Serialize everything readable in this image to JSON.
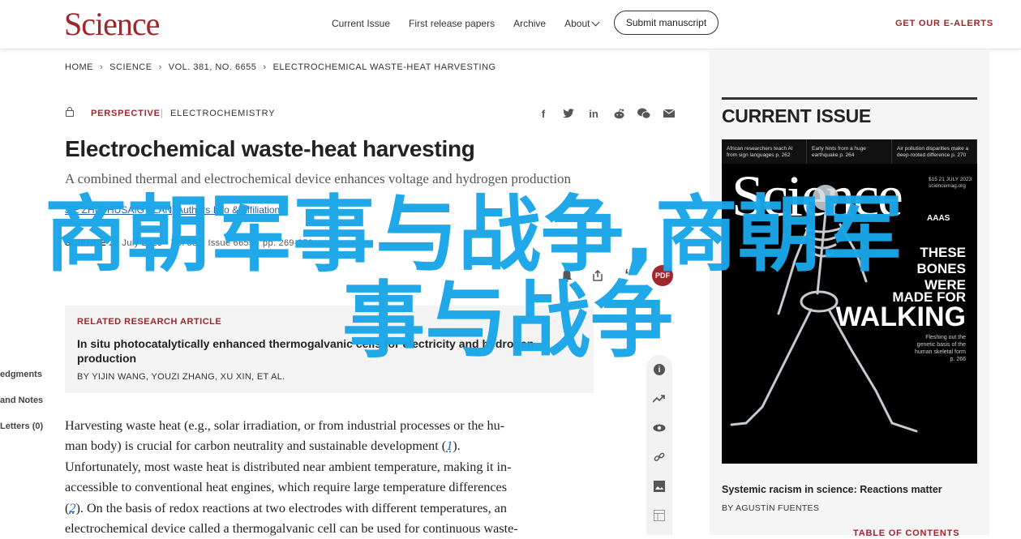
{
  "header": {
    "logo": "Science",
    "nav": [
      "Current Issue",
      "First release papers",
      "Archive",
      "About"
    ],
    "submit": "Submit manuscript",
    "alerts": "GET OUR E-ALERTS"
  },
  "breadcrumb": [
    "HOME",
    "SCIENCE",
    "VOL. 381, NO. 6655",
    "ELECTROCHEMICAL WASTE-HEAT HARVESTING"
  ],
  "article": {
    "section": "PERSPECTIVE",
    "subject": "ELECTROCHEMISTRY",
    "title": "Electrochemical waste-heat harvesting",
    "subtitle": "A combined thermal and electrochemical device enhances voltage and hydrogen production",
    "authors": "JIE ZHU, HUSAIG ALAN, Authors Info & Affiliations",
    "meta_journal": "SCIENCE",
    "meta_rest": "20 July 2023 · Vol 381, Issue 6655 · pp. 269-270",
    "pdf_label": "PDF"
  },
  "related": {
    "label": "RELATED RESEARCH ARTICLE",
    "title": "In situ photocatalytically enhanced thermogalvanic cells for electricity and hydrogen production",
    "by": "BY YIJIN WANG, YOUZI ZHANG, XU XIN, ET AL."
  },
  "sidebar": [
    "edgments",
    "and Notes",
    "Letters (0)"
  ],
  "body_lines": [
    {
      "pre": "Harvesting waste heat (e.g., solar irradiation, or from industrial processes or the hu-",
      "ref": "",
      "post": ""
    },
    {
      "pre": "man body) is crucial for carbon neutrality and sustainable development (",
      "ref": "1",
      "post": ")."
    },
    {
      "pre": "Unfortunately, most waste heat is distributed near ambient temperature, making it in-",
      "ref": "",
      "post": ""
    },
    {
      "pre": "accessible to conventional heat engines, which require large temperature differences",
      "ref": "",
      "post": ""
    },
    {
      "pre": "(",
      "ref": "2",
      "post": "). On the basis of redox reactions at two electrodes with different temperatures, an"
    },
    {
      "pre": "electrochemical device called a thermogalvanic cell can be used for continuous waste-",
      "ref": "",
      "post": ""
    }
  ],
  "current_issue": {
    "heading": "CURRENT ISSUE",
    "cover": {
      "top_items": [
        "African researchers teach AI from sign languages p. 262",
        "Early hints from a huge earthquake p. 264",
        "Air pollution disparities make a deep-rooted difference p. 270"
      ],
      "logo": "Science",
      "issue": "$15 21 JULY 2023 sciencemag.org",
      "aaas": "AAAS",
      "headline": [
        "THESE",
        "BONES",
        "WERE",
        "MADE FOR",
        "WALKING"
      ],
      "sub": "Fleshing out the genetic basis of the human skeletal form p. 266"
    },
    "caption": "Systemic racism in science: Reactions matter",
    "by": "BY AGUSTÍN FUENTES",
    "toc": "TABLE OF CONTENTS"
  },
  "watermark": {
    "line1": "商朝军事与战争,商朝军",
    "line2": "事与战争"
  },
  "colors": {
    "brand": "#a0262c",
    "link": "#2b5ea8",
    "watermark": "#1aa6e8"
  }
}
